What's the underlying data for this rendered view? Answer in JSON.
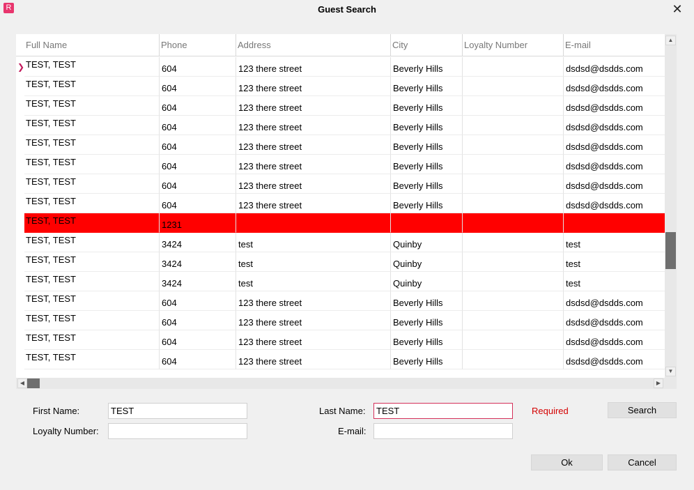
{
  "window": {
    "title": "Guest Search",
    "logo_letter": "R",
    "close_glyph": "✕"
  },
  "grid": {
    "columns": [
      "Full Name",
      "Phone",
      "Address",
      "City",
      "Loyalty Number",
      "E-mail"
    ],
    "selected_row_index": 0,
    "highlighted_row_index": 8,
    "highlight_color": "#ff0000",
    "rows": [
      [
        "TEST, TEST",
        "604",
        "123 there street",
        "Beverly Hills",
        "",
        "dsdsd@dsdds.com"
      ],
      [
        "TEST, TEST",
        "604",
        "123 there street",
        "Beverly Hills",
        "",
        "dsdsd@dsdds.com"
      ],
      [
        "TEST, TEST",
        "604",
        "123 there street",
        "Beverly Hills",
        "",
        "dsdsd@dsdds.com"
      ],
      [
        "TEST, TEST",
        "604",
        "123 there street",
        "Beverly Hills",
        "",
        "dsdsd@dsdds.com"
      ],
      [
        "TEST, TEST",
        "604",
        "123 there street",
        "Beverly Hills",
        "",
        "dsdsd@dsdds.com"
      ],
      [
        "TEST, TEST",
        "604",
        "123 there street",
        "Beverly Hills",
        "",
        "dsdsd@dsdds.com"
      ],
      [
        "TEST, TEST",
        "604",
        "123 there street",
        "Beverly Hills",
        "",
        "dsdsd@dsdds.com"
      ],
      [
        "TEST, TEST",
        "604",
        "123 there street",
        "Beverly Hills",
        "",
        "dsdsd@dsdds.com"
      ],
      [
        "TEST, TEST",
        "1231",
        "",
        "",
        "",
        ""
      ],
      [
        "TEST, TEST",
        "3424",
        "test",
        "Quinby",
        "",
        "test"
      ],
      [
        "TEST, TEST",
        "3424",
        "test",
        "Quinby",
        "",
        "test"
      ],
      [
        "TEST, TEST",
        "3424",
        "test",
        "Quinby",
        "",
        "test"
      ],
      [
        "TEST, TEST",
        "604",
        "123 there street",
        "Beverly Hills",
        "",
        "dsdsd@dsdds.com"
      ],
      [
        "TEST, TEST",
        "604",
        "123 there street",
        "Beverly Hills",
        "",
        "dsdsd@dsdds.com"
      ],
      [
        "TEST, TEST",
        "604",
        "123 there street",
        "Beverly Hills",
        "",
        "dsdsd@dsdds.com"
      ],
      [
        "TEST, TEST",
        "604",
        "123 there street",
        "Beverly Hills",
        "",
        "dsdsd@dsdds.com"
      ]
    ]
  },
  "form": {
    "first_name_label": "First Name:",
    "first_name_value": "TEST",
    "loyalty_label": "Loyalty Number:",
    "loyalty_value": "",
    "last_name_label": "Last Name:",
    "last_name_value": "TEST",
    "email_label": "E-mail:",
    "email_value": "",
    "required_text": "Required",
    "search_label": "Search",
    "ok_label": "Ok",
    "cancel_label": "Cancel"
  },
  "colors": {
    "accent": "#e8356d",
    "required": "#d40000"
  }
}
